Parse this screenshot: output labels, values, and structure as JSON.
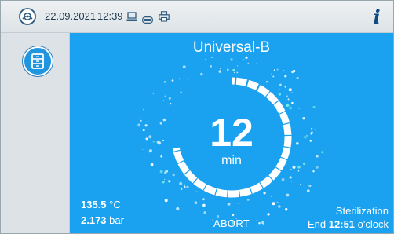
{
  "status_bar": {
    "date": "22.09.2021",
    "time": "12:39",
    "icons": [
      "device-icon",
      "computer-icon",
      "usb-stick-icon",
      "printer-icon"
    ],
    "info_label": "i"
  },
  "sidebar": {
    "menu_icon": "drawer-menu-icon"
  },
  "main": {
    "program_name": "Universal-B",
    "remaining_time": "12",
    "remaining_unit": "min",
    "progress_fraction": 0.72,
    "temperature_value": "135.5",
    "temperature_unit": "°C",
    "pressure_value": "2.173",
    "pressure_unit": "bar",
    "abort_label": "ABORT",
    "phase": "Sterilization",
    "end_prefix": "End",
    "end_time": "12:51",
    "end_suffix": "o'clock"
  },
  "colors": {
    "panel_blue": "#1aa1f0",
    "ring_done": "#ffffff",
    "ring_pending": "#1d5c8c",
    "header_text": "#1d3a52",
    "info_blue": "#0d4a82"
  }
}
